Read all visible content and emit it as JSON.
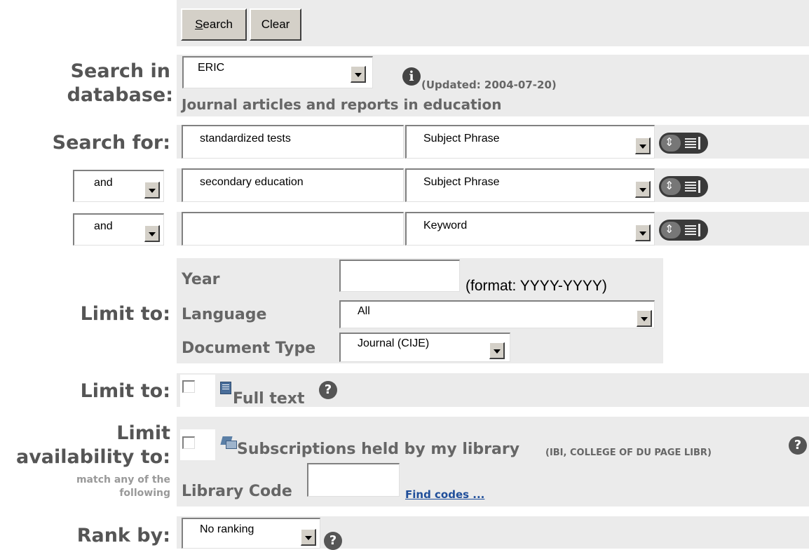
{
  "buttons": {
    "search": "Search",
    "clear": "Clear"
  },
  "database": {
    "label_line1": "Search in",
    "label_line2": "database:",
    "selected": "ERIC",
    "updated": "(Updated: 2004-07-20)",
    "description": "Journal articles and reports in education"
  },
  "search_for": {
    "label": "Search for:",
    "rows": [
      {
        "operator": "",
        "term": "standardized tests",
        "field": "Subject Phrase"
      },
      {
        "operator": "and",
        "term": "secondary education",
        "field": "Subject Phrase"
      },
      {
        "operator": "and",
        "term": "",
        "field": "Keyword"
      }
    ]
  },
  "limits": {
    "label": "Limit to:",
    "year_label": "Year",
    "year_value": "",
    "year_format": "(format: YYYY-YYYY)",
    "language_label": "Language",
    "language_value": "All",
    "doctype_label": "Document Type",
    "doctype_value": "Journal (CIJE)"
  },
  "fulltext": {
    "label": "Limit to:",
    "text": "Full text"
  },
  "availability": {
    "label_line1": "Limit",
    "label_line2": "availability to:",
    "sub_line1": "match any of the",
    "sub_line2": "following",
    "subscriptions_text": "Subscriptions held by my library",
    "library_name": "(IBI, COLLEGE OF DU PAGE LIBR)",
    "library_code_label": "Library Code",
    "library_code_value": "",
    "find_codes": "Find codes ..."
  },
  "rank": {
    "label": "Rank by:",
    "value": "No ranking"
  },
  "icons": {
    "info": "info-icon",
    "help": "help-icon",
    "index": "browse-index-icon",
    "fulltext": "document-icon",
    "subscriptions": "library-icon"
  }
}
